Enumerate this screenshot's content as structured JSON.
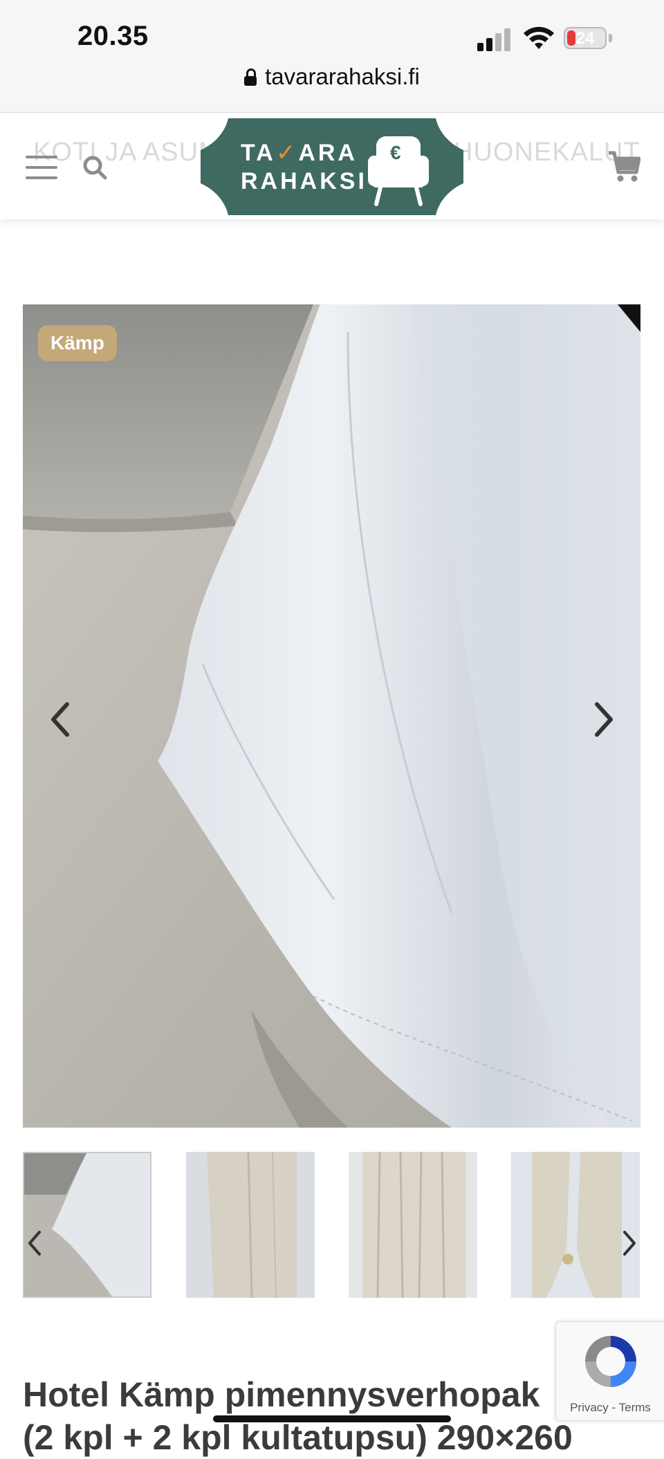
{
  "status_bar": {
    "time": "20.35",
    "battery": "24",
    "battery_level": 0.24,
    "icons": [
      "cellular-signal-icon",
      "wifi-icon",
      "battery-icon"
    ]
  },
  "browser": {
    "url": "tavararahaksi.fi",
    "lock_icon": "lock-icon"
  },
  "header": {
    "nav_ghost_left": "KOTI JA ASUMINEN",
    "nav_ghost_right": "HUONEKALUT",
    "logo_line1_a": "TA",
    "logo_line1_b": "ARA",
    "logo_line2": "RAHAKSI",
    "logo_euro": "€",
    "icons": [
      "menu-icon",
      "search-icon",
      "cart-icon"
    ]
  },
  "product": {
    "badge": "Kämp",
    "title_line1": "Hotel Kämp pimennysverhopak",
    "title_line2": "(2 kpl + 2 kpl kultatupsu) 290×260",
    "gallery": {
      "thumbnail_count": 4,
      "active_index": 0
    }
  },
  "recaptcha": {
    "privacy": "Privacy",
    "separator": "-",
    "terms": "Terms"
  },
  "colors": {
    "brand_green": "#3e6a62",
    "brand_orange": "#f28c2c",
    "badge": "#c4a878",
    "title": "#3b3b3b"
  }
}
